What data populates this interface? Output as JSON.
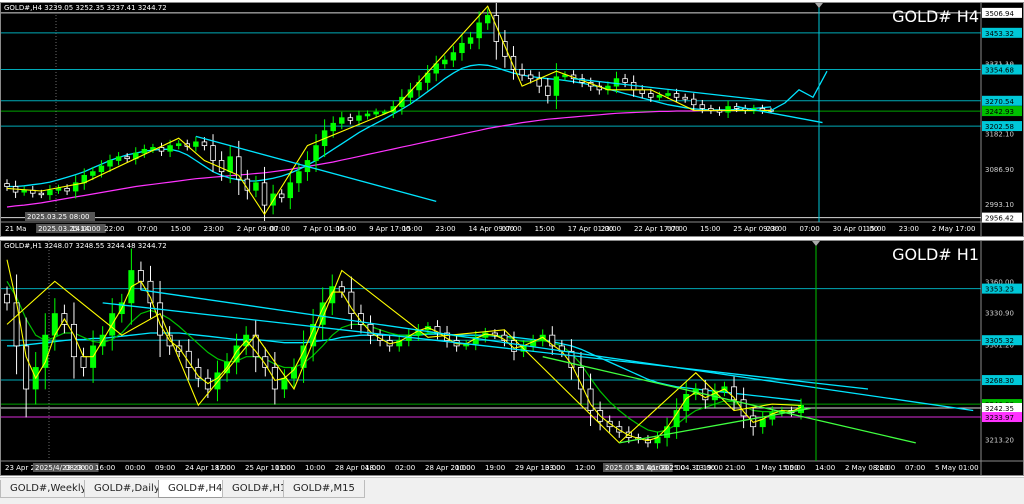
{
  "window": {
    "tabs": [
      {
        "label": "GOLD#,Weekly",
        "active": false
      },
      {
        "label": "GOLD#,Daily",
        "active": false
      },
      {
        "label": "GOLD#,H4",
        "active": true
      },
      {
        "label": "GOLD#,H1",
        "active": false
      },
      {
        "label": "GOLD#,M15",
        "active": false
      }
    ]
  },
  "colors": {
    "bull": "#00ff00",
    "bear": "#ffffff",
    "ma_fast": "#ffff00",
    "ma_mid": "#00c000",
    "ma_slow": "#00e5ff",
    "ma_long": "#ff33ff",
    "level": "#00c8d8",
    "trend": "#00e5ff",
    "trend_green": "#40ff40",
    "cursor": "#00ff66"
  },
  "chart_data": [
    {
      "type": "candlestick",
      "title": "GOLD# H4",
      "info": "GOLD#,H4  3239.05 3252.35 3237.41 3244.72",
      "ylim": [
        2950,
        3512
      ],
      "y_ticks": [
        "3506.94",
        "3453.32",
        "3364.90",
        "3354.68",
        "3371.10",
        "3270.54",
        "3242.93",
        "3202.58",
        "3182.10",
        "3086.90",
        "2993.10",
        "2956.42"
      ],
      "level_labels": [
        {
          "value": 3506.94,
          "label": "3506.94",
          "color": "#ffffff"
        },
        {
          "value": 3453.32,
          "label": "3453.32",
          "color": "#00c8d8"
        },
        {
          "value": 3354.68,
          "label": "3354.68",
          "color": "#00c8d8"
        },
        {
          "value": 3270.54,
          "label": "3270.54",
          "color": "#00c8d8"
        },
        {
          "value": 3242.93,
          "label": "3242.93",
          "color": "#00c000"
        },
        {
          "value": 3202.58,
          "label": "3202.58",
          "color": "#00c8d8"
        },
        {
          "value": 2956.42,
          "label": "2956.42",
          "color": "#ffffff"
        }
      ],
      "x_labels": [
        "21 Ma",
        "2025.03.25 14:00",
        "14:00",
        "22:00",
        "07:00",
        "15:00",
        "23:00",
        "2 Apr 09:00",
        "07:00",
        "7 Apr 01:00",
        "15:00",
        "9 Apr 17:00",
        "15:00",
        "23:00",
        "14 Apr 09:00",
        "07:00",
        "15:00",
        "17 Apr 01:00",
        "23:00",
        "22 Apr 17:00",
        "07:00",
        "15:00",
        "25 Apr 09:00",
        "23:00",
        "07:00",
        "30 Apr 01:00",
        "15:00",
        "23:00",
        "2 May 17:00"
      ],
      "x_label_highlight": "2025.03.25 08:00",
      "closes": [
        3040,
        3025,
        3030,
        3022,
        3018,
        3030,
        3035,
        3028,
        3050,
        3070,
        3080,
        3095,
        3110,
        3120,
        3115,
        3130,
        3140,
        3145,
        3135,
        3150,
        3155,
        3148,
        3160,
        3150,
        3110,
        3080,
        3120,
        3060,
        3030,
        3050,
        2990,
        3020,
        3010,
        3050,
        3080,
        3110,
        3150,
        3190,
        3210,
        3225,
        3218,
        3230,
        3235,
        3240,
        3240,
        3255,
        3280,
        3300,
        3320,
        3345,
        3370,
        3380,
        3400,
        3425,
        3440,
        3480,
        3500,
        3430,
        3390,
        3355,
        3340,
        3330,
        3310,
        3285,
        3335,
        3340,
        3330,
        3320,
        3310,
        3300,
        3310,
        3330,
        3320,
        3300,
        3290,
        3280,
        3285,
        3290,
        3280,
        3275,
        3260,
        3250,
        3245,
        3240,
        3255,
        3250,
        3245,
        3250,
        3245,
        3244.72
      ],
      "ma_slow": [
        3040,
        3040,
        3042,
        3045,
        3048,
        3052,
        3058,
        3065,
        3072,
        3080,
        3090,
        3100,
        3110,
        3118,
        3125,
        3130,
        3135,
        3138,
        3140,
        3140,
        3135,
        3125,
        3110,
        3095,
        3080,
        3070,
        3062,
        3058,
        3055,
        3055,
        3058,
        3062,
        3068,
        3076,
        3086,
        3098,
        3110,
        3125,
        3140,
        3155,
        3170,
        3185,
        3198,
        3210,
        3222,
        3235,
        3248,
        3262,
        3278,
        3295,
        3312,
        3330,
        3345,
        3358,
        3365,
        3368,
        3366,
        3360,
        3352,
        3345,
        3340,
        3336,
        3333,
        3330,
        3328,
        3325,
        3322,
        3318,
        3313,
        3308,
        3302,
        3296,
        3290,
        3284,
        3278,
        3272,
        3266,
        3260,
        3256,
        3252,
        3249,
        3247,
        3246,
        3246,
        3246,
        3247,
        3248,
        3250,
        3252,
        3254
      ],
      "ma_long": [
        2985,
        2988,
        2990,
        2993,
        2996,
        3000,
        3004,
        3008,
        3012,
        3016,
        3020,
        3024,
        3028,
        3032,
        3036,
        3040,
        3043,
        3046,
        3049,
        3052,
        3055,
        3058,
        3061,
        3063,
        3065,
        3067,
        3069,
        3071,
        3073,
        3075,
        3077,
        3080,
        3083,
        3086,
        3090,
        3094,
        3098,
        3102,
        3106,
        3111,
        3116,
        3121,
        3126,
        3131,
        3136,
        3141,
        3146,
        3151,
        3156,
        3161,
        3166,
        3171,
        3176,
        3181,
        3186,
        3191,
        3196,
        3200,
        3204,
        3208,
        3212,
        3215,
        3218,
        3221,
        3223,
        3225,
        3227,
        3229,
        3231,
        3233,
        3235,
        3237,
        3238,
        3239,
        3240,
        3241,
        3242,
        3242,
        3243,
        3243,
        3243,
        3244,
        3244,
        3244,
        3244,
        3244,
        3245,
        3245,
        3245,
        3245
      ],
      "projection": [
        3244.72,
        3265,
        3300,
        3280,
        3350
      ]
    },
    {
      "type": "candlestick",
      "title": "GOLD# H1",
      "info": "GOLD#,H1  3248.07 3248.55 3244.48 3244.72",
      "ylim": [
        3195,
        3390
      ],
      "y_ticks": [
        "3360.00",
        "3353.23",
        "3330.90",
        "3305.32",
        "3301.20",
        "3268.30",
        "3246.00",
        "3242.35",
        "3233.97",
        "3213.20"
      ],
      "level_labels": [
        {
          "value": 3353.23,
          "label": "3353.23",
          "color": "#00c8d8"
        },
        {
          "value": 3305.32,
          "label": "3305.32",
          "color": "#00c8d8"
        },
        {
          "value": 3268.3,
          "label": "3268.30",
          "color": "#00c8d8"
        },
        {
          "value": 3246.0,
          "label": "3246.00",
          "color": "#00c000"
        },
        {
          "value": 3242.35,
          "label": "3242.35",
          "color": "#ffffff"
        },
        {
          "value": 3233.97,
          "label": "3233.97",
          "color": "#ff33ff"
        }
      ],
      "x_labels": [
        "23 Apr 2025",
        "2025/4/23 23:00",
        "08:00",
        "16:00",
        "00:00",
        "09:00",
        "24 Apr 18:00",
        "17:00",
        "25 Apr 11:00",
        "01:00",
        "10:00",
        "28 Apr 04:00",
        "18:00",
        "02:00",
        "28 Apr 20:00",
        "10:00",
        "19:00",
        "29 Apr 13:00",
        "03:00",
        "12:00",
        "2025.05.01 01:00",
        "30 Apr 2025.04.30 19:00",
        "22:00",
        "13:00",
        "21:00",
        "1 May 15:00",
        "05:00",
        "14:00",
        "2 May 08:00",
        "22:00",
        "07:00",
        "5 May 01:00"
      ],
      "closes": [
        3340,
        3300,
        3260,
        3280,
        3310,
        3330,
        3320,
        3290,
        3280,
        3300,
        3310,
        3330,
        3340,
        3370,
        3360,
        3340,
        3310,
        3300,
        3295,
        3280,
        3270,
        3260,
        3275,
        3285,
        3300,
        3310,
        3290,
        3280,
        3260,
        3270,
        3280,
        3300,
        3320,
        3340,
        3355,
        3350,
        3330,
        3320,
        3310,
        3305,
        3300,
        3305,
        3310,
        3315,
        3318,
        3312,
        3305,
        3300,
        3302,
        3308,
        3312,
        3310,
        3305,
        3295,
        3300,
        3305,
        3310,
        3300,
        3295,
        3280,
        3260,
        3240,
        3230,
        3225,
        3220,
        3215,
        3213,
        3210,
        3215,
        3225,
        3240,
        3255,
        3260,
        3250,
        3258,
        3262,
        3250,
        3235,
        3225,
        3232,
        3238,
        3240,
        3238,
        3244.72
      ],
      "ma_fast": [
        3380,
        3340,
        3290,
        3270,
        3285,
        3310,
        3325,
        3310,
        3290,
        3290,
        3305,
        3320,
        3335,
        3355,
        3360,
        3345,
        3320,
        3305,
        3298,
        3285,
        3272,
        3265,
        3270,
        3280,
        3295,
        3305,
        3295,
        3283,
        3268,
        3270,
        3278,
        3295,
        3315,
        3335,
        3350,
        3350,
        3335,
        3323,
        3313,
        3307,
        3302,
        3304,
        3309,
        3314,
        3317,
        3313,
        3307,
        3302,
        3302,
        3307,
        3311,
        3310,
        3306,
        3298,
        3300,
        3304,
        3308,
        3301,
        3295,
        3283,
        3265,
        3246,
        3235,
        3228,
        3222,
        3217,
        3214,
        3212,
        3215,
        3224,
        3237,
        3251,
        3257,
        3252,
        3256,
        3260,
        3252,
        3239,
        3229,
        3232,
        3237,
        3240,
        3239,
        3243
      ],
      "ma_mid": [
        3360,
        3345,
        3325,
        3310,
        3305,
        3308,
        3312,
        3312,
        3308,
        3304,
        3303,
        3306,
        3312,
        3322,
        3330,
        3333,
        3330,
        3325,
        3318,
        3310,
        3302,
        3294,
        3288,
        3285,
        3286,
        3290,
        3290,
        3288,
        3283,
        3280,
        3280,
        3284,
        3291,
        3300,
        3310,
        3317,
        3320,
        3320,
        3318,
        3315,
        3312,
        3310,
        3310,
        3311,
        3312,
        3312,
        3311,
        3309,
        3308,
        3308,
        3309,
        3310,
        3309,
        3306,
        3304,
        3304,
        3305,
        3303,
        3300,
        3293,
        3283,
        3270,
        3258,
        3248,
        3240,
        3233,
        3227,
        3222,
        3220,
        3222,
        3227,
        3234,
        3240,
        3243,
        3246,
        3249,
        3248,
        3244,
        3240,
        3239,
        3239,
        3240,
        3240,
        3241
      ],
      "ma_slow": [
        3300,
        3300,
        3301,
        3302,
        3303,
        3304,
        3305,
        3306,
        3306,
        3307,
        3307,
        3308,
        3309,
        3310,
        3311,
        3312,
        3312,
        3312,
        3312,
        3311,
        3310,
        3309,
        3308,
        3307,
        3306,
        3306,
        3306,
        3305,
        3304,
        3303,
        3303,
        3303,
        3304,
        3305,
        3306,
        3308,
        3309,
        3310,
        3310,
        3310,
        3310,
        3310,
        3310,
        3310,
        3311,
        3311,
        3311,
        3310,
        3310,
        3310,
        3310,
        3309,
        3309,
        3308,
        3307,
        3306,
        3305,
        3304,
        3302,
        3300,
        3297,
        3293,
        3289,
        3285,
        3281,
        3277,
        3273,
        3269,
        3266,
        3264,
        3262,
        3261,
        3260,
        3259,
        3258,
        3257,
        3256,
        3255,
        3254,
        3253,
        3252,
        3251,
        3250,
        3249
      ]
    }
  ]
}
